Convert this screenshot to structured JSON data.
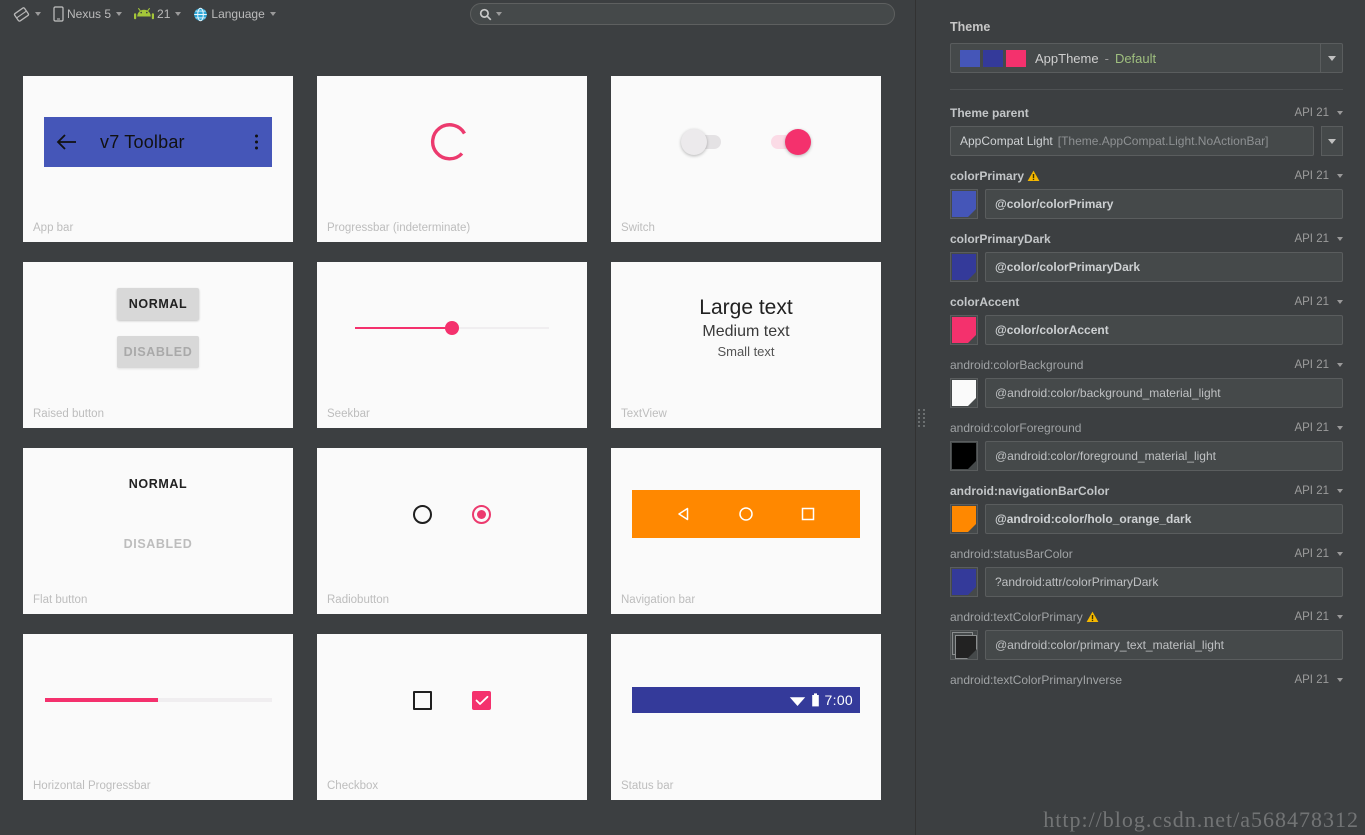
{
  "toolbar": {
    "items": [
      {
        "icon": "rotate-icon",
        "label": "",
        "caret": true
      },
      {
        "icon": "device-icon",
        "label": "Nexus 5",
        "caret": true
      },
      {
        "icon": "android-icon",
        "label": "21",
        "caret": true
      },
      {
        "icon": "globe-icon",
        "label": "Language",
        "caret": true
      }
    ],
    "search": {
      "placeholder": "",
      "value": "",
      "icon": "search-icon"
    }
  },
  "preview": {
    "cards": [
      {
        "id": "app-bar",
        "label": "App bar",
        "title": "v7 Toolbar",
        "back_icon": "arrow-back-icon",
        "overflow_icon": "overflow-menu-icon",
        "color": "#4556b8"
      },
      {
        "id": "progressbar-indeterminate",
        "label": "Progressbar (indeterminate)",
        "color": "#ec3a6e"
      },
      {
        "id": "switch",
        "label": "Switch",
        "off_color": "#e4e2e4",
        "on_color": "#f4316d",
        "on_track": "#fbdbe6"
      },
      {
        "id": "raised-button",
        "label": "Raised button",
        "normal_text": "NORMAL",
        "disabled_text": "DISABLED"
      },
      {
        "id": "seekbar",
        "label": "Seekbar",
        "color": "#f4316d",
        "value_percent": 50
      },
      {
        "id": "textview",
        "label": "TextView",
        "large": "Large text",
        "medium": "Medium text",
        "small": "Small text"
      },
      {
        "id": "flat-button",
        "label": "Flat button",
        "normal_text": "NORMAL",
        "disabled_text": "DISABLED"
      },
      {
        "id": "radiobutton",
        "label": "Radiobutton",
        "checked_color": "#ec3a6e"
      },
      {
        "id": "navigation-bar",
        "label": "Navigation bar",
        "color": "#ff8800",
        "icons": [
          "back-triangle-icon",
          "home-circle-icon",
          "recents-square-icon"
        ]
      },
      {
        "id": "horizontal-progressbar",
        "label": "Horizontal Progressbar",
        "color": "#f4316d",
        "value_percent": 50
      },
      {
        "id": "checkbox",
        "label": "Checkbox",
        "checked_color": "#f4316d",
        "check_icon": "checkmark-icon"
      },
      {
        "id": "status-bar",
        "label": "Status bar",
        "color": "#343a9a",
        "clock": "7:00",
        "icons": [
          "wifi-icon",
          "battery-icon"
        ]
      }
    ]
  },
  "theme_editor": {
    "heading": "Theme",
    "theme_combo": {
      "swatches": [
        "#4556b8",
        "#343a9a",
        "#f4316d"
      ],
      "name": "AppTheme",
      "separator": "-",
      "variant": "Default"
    },
    "properties": [
      {
        "name": "Theme parent",
        "bold": true,
        "warn": false,
        "api": "API 21",
        "value_main": "AppCompat Light",
        "value_sub": "[Theme.AppCompat.Light.NoActionBar]",
        "chip": null
      },
      {
        "name": "colorPrimary",
        "bold": true,
        "warn": true,
        "api": "API 21",
        "value": "@color/colorPrimary",
        "chip": "#4556b8",
        "chip_style": "solid",
        "value_bold": true
      },
      {
        "name": "colorPrimaryDark",
        "bold": true,
        "warn": false,
        "api": "API 21",
        "value": "@color/colorPrimaryDark",
        "chip": "#343a9a",
        "chip_style": "solid",
        "value_bold": true
      },
      {
        "name": "colorAccent",
        "bold": true,
        "warn": false,
        "api": "API 21",
        "value": "@color/colorAccent",
        "chip": "#f4316d",
        "chip_style": "solid",
        "value_bold": true
      },
      {
        "name": "android:colorBackground",
        "bold": false,
        "warn": false,
        "api": "API 21",
        "value": "@android:color/background_material_light",
        "chip": "#fafafa",
        "chip_style": "solid",
        "value_bold": false
      },
      {
        "name": "android:colorForeground",
        "bold": false,
        "warn": false,
        "api": "API 21",
        "value": "@android:color/foreground_material_light",
        "chip": "#000000",
        "chip_style": "solid",
        "value_bold": false
      },
      {
        "name": "android:navigationBarColor",
        "bold": true,
        "warn": false,
        "api": "API 21",
        "value": "@android:color/holo_orange_dark",
        "chip": "#ff8800",
        "chip_style": "solid",
        "value_bold": true
      },
      {
        "name": "android:statusBarColor",
        "bold": false,
        "warn": false,
        "api": "API 21",
        "value": "?android:attr/colorPrimaryDark",
        "chip": "#343a9a",
        "chip_style": "solid",
        "value_bold": false
      },
      {
        "name": "android:textColorPrimary",
        "bold": false,
        "warn": true,
        "api": "API 21",
        "value": "@android:color/primary_text_material_light",
        "chip": "#222222",
        "chip_style": "stacked",
        "value_bold": false
      },
      {
        "name": "android:textColorPrimaryInverse",
        "bold": false,
        "warn": false,
        "api": "API 21",
        "value": "",
        "chip": null,
        "value_bold": false
      }
    ]
  },
  "watermark": "http://blog.csdn.net/a568478312"
}
